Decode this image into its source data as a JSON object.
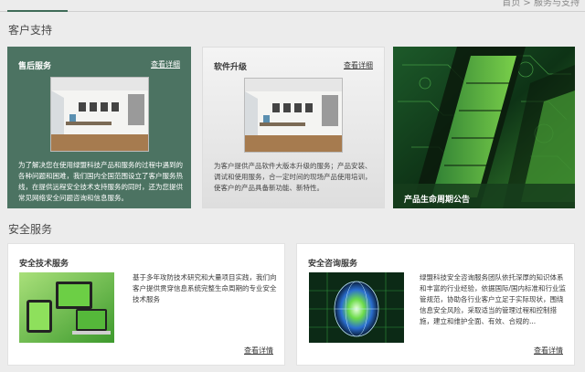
{
  "breadcrumb": "首页 > 服务与支持",
  "sections": {
    "support_title": "客户支持",
    "security_title": "安全服务"
  },
  "support_cards": [
    {
      "title": "售后服务",
      "more": "查看详细",
      "desc": "为了解决您在使用绿盟科技产品和服务的过程中遇到的各种问题和困难，我们国内全国范围设立了客户服务热线，在提供远程安全技术支持服务的同时，还为您提供常见网络安全问题咨询和信息服务。"
    },
    {
      "title": "软件升级",
      "more": "查看详细",
      "desc": "为客户提供产品软件大版本升级的服务；产品安装、调试和使用服务，合一定时间的现场产品使用培训，使客户的产品具备新功能、新特性。"
    },
    {
      "title": "产品生命周期公告"
    }
  ],
  "security_cards": [
    {
      "title": "安全技术服务",
      "more": "查看详情",
      "desc": "基于多年攻防技术研究和大量项目实践，我们向客户提供贯穿信息系统完整生命周期的专业安全技术服务"
    },
    {
      "title": "安全咨询服务",
      "more": "查看详情",
      "desc": "绿盟科技安全咨询服务团队依托深厚的知识体系和丰富的行业经验，依据国际/国内标准和行业监管规范，协助各行业客户立足于实际现状，围绕信息安全风险，采取适当的管理过程和控制措施，建立和维护全面、有效、合规的..."
    }
  ],
  "colors": {
    "accent_green": "#4c7362",
    "link_dark": "#3a3a3a"
  }
}
